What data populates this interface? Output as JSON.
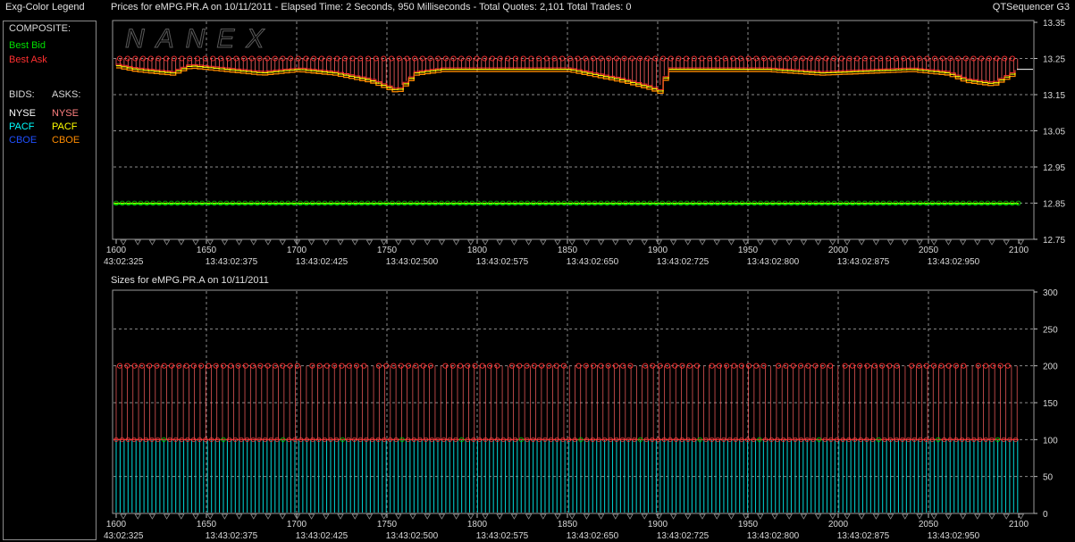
{
  "header": {
    "legend_title": "Exg-Color Legend",
    "prices_title": "Prices for  eMPG.PR.A  on  10/11/2011   -  Elapsed Time: 2 Seconds, 950 Milliseconds   -  Total Quotes: 2,101   Total Trades: 0",
    "app_name": "QTSequencer G3",
    "sizes_title": "Sizes for  eMPG.PR.A  on  10/11/2011"
  },
  "legend": {
    "composite_label": "COMPOSITE:",
    "best_bid": "Best Bid",
    "best_ask": "Best Ask",
    "bids_label": "BIDS:",
    "asks_label": "ASKS:",
    "bids": [
      "NYSE",
      "PACF",
      "CBOE"
    ],
    "asks": [
      "NYSE",
      "PACF",
      "CBOE"
    ],
    "colors": {
      "best_bid": "#00e000",
      "best_ask": "#ff3030",
      "bid_nyse": "#ffffff",
      "bid_pacf": "#00ffff",
      "bid_cboe": "#2050ff",
      "ask_nyse": "#ff8080",
      "ask_pacf": "#ffff00",
      "ask_cboe": "#ff8c00"
    }
  },
  "watermark": "NANEX",
  "chart_data": [
    {
      "type": "line",
      "title": "Prices",
      "x_range": [
        1600,
        2100
      ],
      "x_ticks": [
        1600,
        1650,
        1700,
        1750,
        1800,
        1850,
        1900,
        1950,
        2000,
        2050,
        2100
      ],
      "x_time_labels": [
        "43:02:325",
        "13:43:02:375",
        "13:43:02:425",
        "13:43:02:500",
        "13:43:02:575",
        "13:43:02:650",
        "13:43:02:725",
        "13:43:02:800",
        "13:43:02:875",
        "13:43:02:950"
      ],
      "y_ticks": [
        "13.35",
        "13.25",
        "13.15",
        "13.05",
        "12.95",
        "12.85",
        "12.75"
      ],
      "ylim": [
        12.75,
        13.35
      ],
      "series": [
        {
          "name": "Best Bid",
          "color": "#00e000",
          "value": 12.85
        },
        {
          "name": "Best Ask",
          "color": "#ff3030",
          "x": [
            1600,
            1610,
            1630,
            1640,
            1660,
            1680,
            1700,
            1720,
            1740,
            1755,
            1765,
            1780,
            1800,
            1850,
            1880,
            1895,
            1900,
            1905,
            1920,
            1960,
            1990,
            2040,
            2060,
            2070,
            2085,
            2100
          ],
          "values": [
            13.23,
            13.22,
            13.21,
            13.23,
            13.22,
            13.21,
            13.22,
            13.21,
            13.19,
            13.16,
            13.21,
            13.22,
            13.22,
            13.22,
            13.19,
            13.17,
            13.16,
            13.22,
            13.22,
            13.22,
            13.21,
            13.22,
            13.21,
            13.19,
            13.18,
            13.22
          ]
        },
        {
          "name": "Ask high",
          "color": "#ff3030",
          "value": 13.25
        }
      ]
    },
    {
      "type": "bar",
      "title": "Sizes",
      "x_range": [
        1600,
        2100
      ],
      "x_ticks": [
        1600,
        1650,
        1700,
        1750,
        1800,
        1850,
        1900,
        1950,
        2000,
        2050,
        2100
      ],
      "x_time_labels": [
        "43:02:325",
        "13:43:02:375",
        "13:43:02:425",
        "13:43:02:500",
        "13:43:02:575",
        "13:43:02:650",
        "13:43:02:725",
        "13:43:02:800",
        "13:43:02:875",
        "13:43:02:950"
      ],
      "y_ticks": [
        "300",
        "250",
        "200",
        "150",
        "100",
        "50",
        "0"
      ],
      "ylim": [
        0,
        300
      ],
      "series": [
        {
          "name": "Bid size",
          "color": "#00c8c8",
          "value": 100
        },
        {
          "name": "Ask size",
          "color": "#ff3030",
          "value": 200
        }
      ]
    }
  ]
}
